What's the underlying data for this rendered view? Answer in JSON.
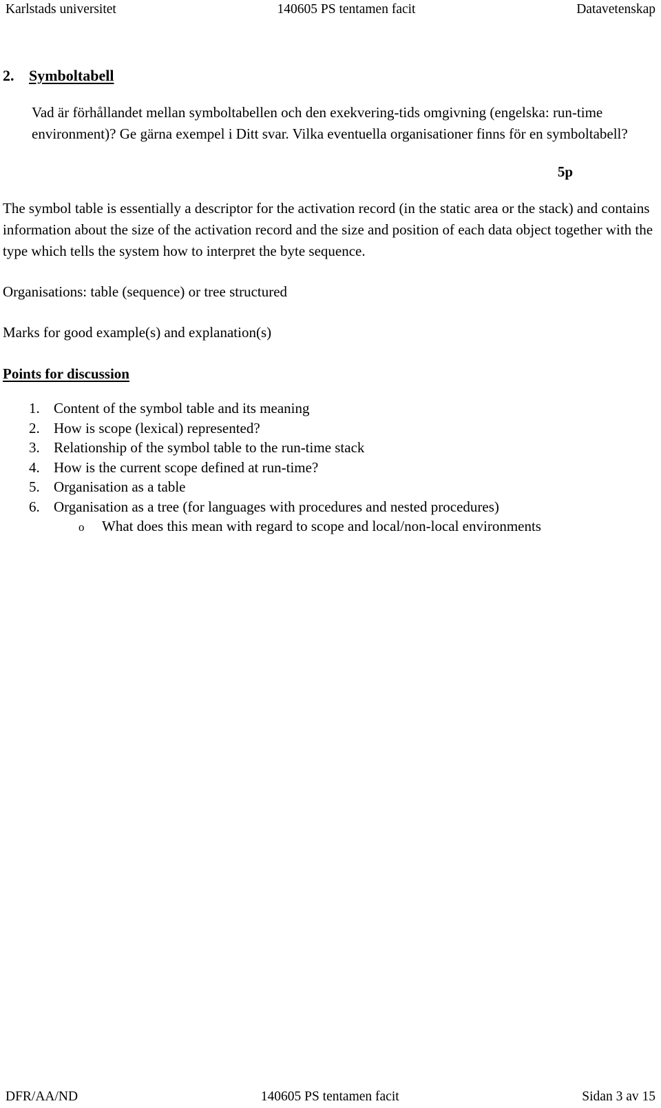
{
  "header": {
    "left": "Karlstads universitet",
    "center": "140605 PS tentamen facit",
    "right": "Datavetenskap"
  },
  "section": {
    "number": "2.",
    "title": "Symboltabell",
    "question": "Vad är förhållandet mellan symboltabellen och den exekvering-tids omgivning (engelska: run-time environment)? Ge gärna exempel i Ditt svar. Vilka eventuella organisationer finns för en symboltabell?",
    "marks": "5p"
  },
  "answer": {
    "paragraph": "The symbol table is essentially a descriptor for the activation record (in the static area or the stack) and contains information about the size of the activation record and the size and position of each data object together with the type which tells the system how to interpret the byte sequence.",
    "organisations": "Organisations: table (sequence) or tree structured",
    "marks_note": "Marks for good example(s) and explanation(s)"
  },
  "points": {
    "heading": "Points for discussion",
    "items": [
      {
        "marker": "1.",
        "text": "Content of the symbol table and its meaning"
      },
      {
        "marker": "2.",
        "text": "How is scope (lexical) represented?"
      },
      {
        "marker": "3.",
        "text": "Relationship of the symbol table to the run-time stack"
      },
      {
        "marker": "4.",
        "text": "How is the current scope defined at run-time?"
      },
      {
        "marker": "5.",
        "text": "Organisation as a table"
      },
      {
        "marker": "6.",
        "text": "Organisation as a tree (for languages with procedures and nested procedures)"
      }
    ],
    "sub_items": [
      {
        "marker": "o",
        "text": "What does this mean with regard to scope and local/non-local environments"
      }
    ]
  },
  "footer": {
    "left": "DFR/AA/ND",
    "center": "140605 PS tentamen facit",
    "right": "Sidan 3 av 15"
  }
}
